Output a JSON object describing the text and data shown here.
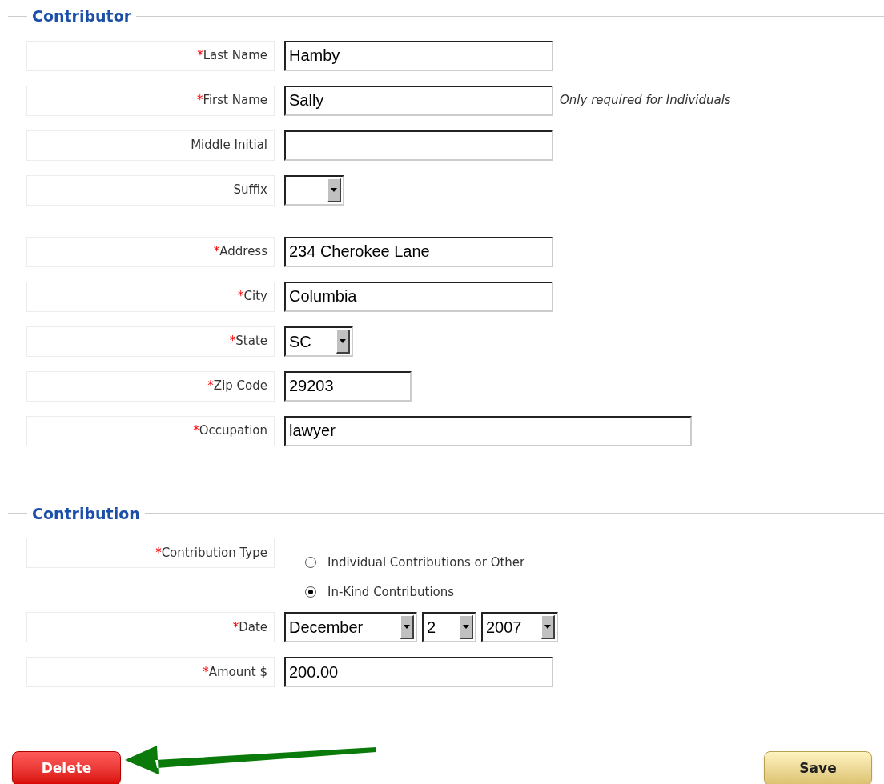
{
  "sections": [
    {
      "title": "Contributor",
      "groups": [
        [
          {
            "kind": "text",
            "required_mark": "*",
            "label": "Last Name",
            "value": "Hamby"
          },
          {
            "kind": "text",
            "required_mark": "*",
            "label": "First Name",
            "value": "Sally",
            "note": "Only required for Individuals"
          },
          {
            "kind": "text",
            "label": "Middle Initial"
          },
          {
            "kind": "select",
            "label": "Suffix"
          }
        ],
        [
          {
            "kind": "text",
            "required_mark": "*",
            "label": "Address",
            "value": "234 Cherokee Lane"
          },
          {
            "kind": "text",
            "required_mark": "*",
            "label": "City",
            "value": "Columbia"
          },
          {
            "kind": "select",
            "required_mark": "*",
            "label": "State",
            "value": "SC"
          },
          {
            "kind": "text",
            "required_mark": "*",
            "label": "Zip Code",
            "value": "29203"
          },
          {
            "kind": "text",
            "required_mark": "*",
            "label": "Occupation",
            "value": "lawyer"
          }
        ]
      ]
    },
    {
      "title": "Contribution",
      "groups": [
        [
          {
            "kind": "radio",
            "required_mark": "*",
            "label": "Contribution Type",
            "options": [
              {
                "label": "Individual Contributions or Other",
                "selected": false
              },
              {
                "label": "In-Kind Contributions",
                "selected": true
              }
            ]
          },
          {
            "kind": "date",
            "required_mark": "*",
            "label": "Date",
            "parts": [
              "December",
              "2",
              "2007"
            ]
          },
          {
            "kind": "text",
            "required_mark": "*",
            "label": "Amount $",
            "value": "200.00"
          }
        ]
      ]
    }
  ],
  "buttons": [
    {
      "kind": "delete",
      "label": "Delete"
    },
    {
      "kind": "save",
      "label": "Save"
    }
  ]
}
